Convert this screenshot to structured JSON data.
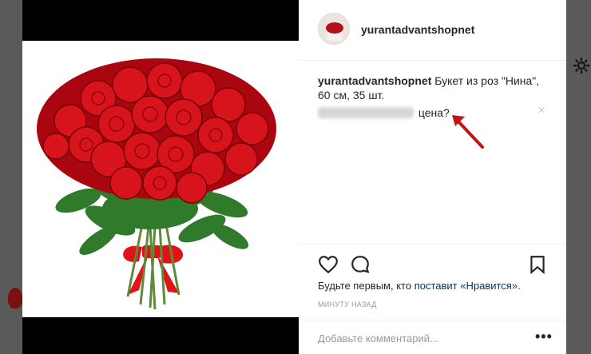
{
  "header": {
    "username": "yurantadvantshopnet"
  },
  "caption": {
    "username": "yurantadvantshopnet",
    "text": "Букет из роз \"Нина\", 60 см, 35 шт."
  },
  "comment": {
    "text": "цена?",
    "close_symbol": "×"
  },
  "likes": {
    "prefix": "Будьте первым, кто ",
    "link": "поставит «Нравится»",
    "suffix": "."
  },
  "timestamp": "МИНУТУ НАЗАД",
  "add_comment": {
    "placeholder": "Добавьте комментарий...",
    "more_symbol": "•••"
  },
  "icons": [
    "heart-icon",
    "comment-icon",
    "bookmark-icon",
    "gear-icon",
    "more-icon",
    "close-icon"
  ],
  "colors": {
    "accent_link": "#003569",
    "text": "#262626",
    "muted": "#999999",
    "annotation_arrow": "#c0141a"
  }
}
